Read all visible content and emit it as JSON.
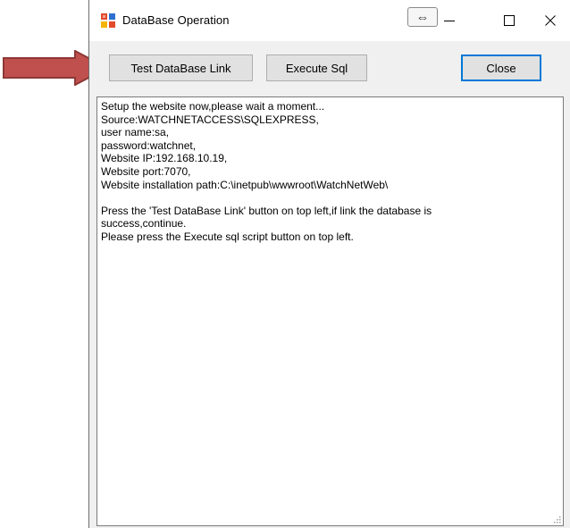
{
  "window": {
    "title": "DataBase Operation",
    "resize_glyph": "⇔"
  },
  "caption_buttons": {
    "minimize_icon": "minimize-icon",
    "maximize_icon": "maximize-icon",
    "close_icon": "close-icon"
  },
  "toolbar": {
    "test_label": "Test DataBase Link",
    "execute_label": "Execute Sql",
    "close_label": "Close"
  },
  "log": {
    "lines": [
      "Setup the website now,please wait a moment...",
      "Source:WATCHNETACCESS\\SQLEXPRESS,",
      "user name:sa,",
      "password:watchnet,",
      "Website IP:192.168.10.19,",
      "Website port:7070,",
      "Website installation path:C:\\inetpub\\wwwroot\\WatchNetWeb\\",
      "",
      "Press the 'Test DataBase Link' button on top left,if link the database is",
      "success,continue.",
      "Please press the Execute sql script button on top left."
    ]
  },
  "colors": {
    "arrow_fill": "#c0504d",
    "arrow_stroke": "#8c3836",
    "default_button_border": "#0078d7"
  }
}
